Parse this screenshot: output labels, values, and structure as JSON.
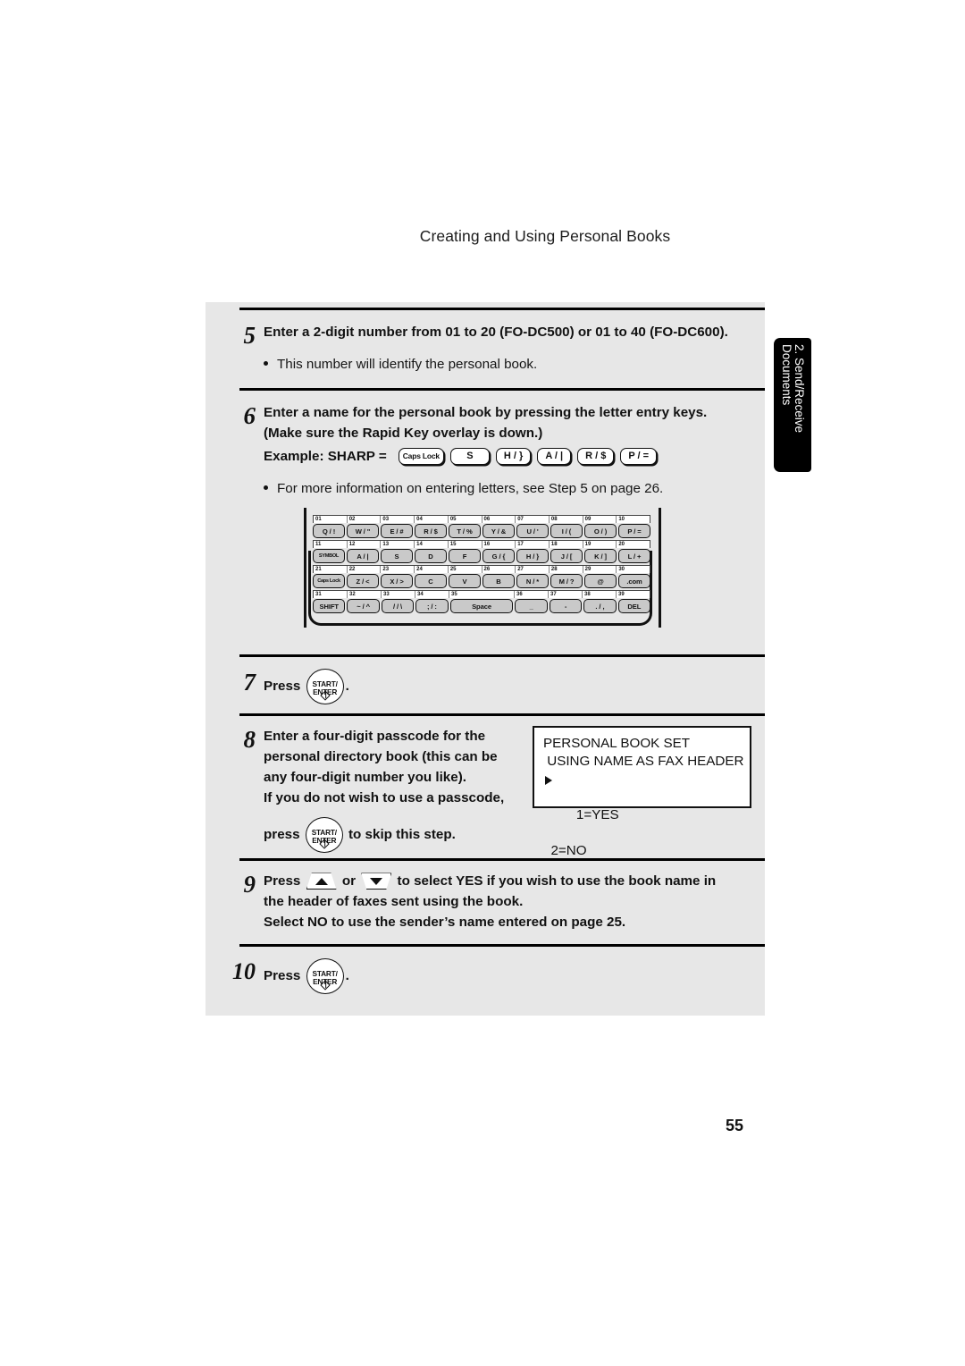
{
  "document": {
    "running_head": "Creating and Using Personal Books",
    "page_number": "55"
  },
  "side_tab": {
    "line1": "2. Send/Receive",
    "line2": "Documents"
  },
  "steps": [
    {
      "number": "5",
      "heading": "Enter a 2-digit number from 01 to 20 (FO-DC500) or 01 to 40 (FO-DC600).",
      "bullet": "This number will identify the personal book."
    },
    {
      "number": "6",
      "heading_line1": "Enter a name for the personal book by pressing the letter entry keys.",
      "heading_line2": "(Make sure the Rapid Key overlay is down.)",
      "example_label": "Example: SHARP =",
      "example_keys": [
        "Caps Lock",
        "S",
        "H / }",
        "A / |",
        "R / $",
        "P / ="
      ],
      "bullet": "For more information on entering letters, see Step 5 on page 26."
    },
    {
      "number": "7",
      "press_label": "Press",
      "period": "."
    },
    {
      "number": "8",
      "line1": "Enter a four-digit passcode for the",
      "line2": "personal directory book (this can be",
      "line3": "any four-digit number you like).",
      "line4": "If you do not wish to use a passcode,",
      "press_label": "press",
      "after_key": "to skip this step."
    },
    {
      "number": "9",
      "press_label": "Press",
      "or_label": "or",
      "line1_tail": "to select YES if you wish to use the book name in",
      "line2": "the header of faxes sent using the book.",
      "line3": "Select NO to use the sender’s name entered on page 25."
    },
    {
      "number": "10",
      "press_label": "Press",
      "period": "."
    }
  ],
  "enter_key": {
    "line1": "START/",
    "line2": "ENTER"
  },
  "lcd": {
    "line1": "PERSONAL BOOK SET",
    "line2": " USING NAME AS FAX HEADER",
    "line3": "1=YES",
    "line4": "  2=NO"
  },
  "keyboard": {
    "rows": [
      {
        "numbers": [
          "01",
          "02",
          "03",
          "04",
          "05",
          "06",
          "07",
          "08",
          "09",
          "10"
        ],
        "keys": [
          {
            "label": "Q / !",
            "flex": 1
          },
          {
            "label": "W / \"",
            "flex": 1
          },
          {
            "label": "E / #",
            "flex": 1
          },
          {
            "label": "R / $",
            "flex": 1
          },
          {
            "label": "T / %",
            "flex": 1
          },
          {
            "label": "Y / &",
            "flex": 1
          },
          {
            "label": "U / '",
            "flex": 1
          },
          {
            "label": "I / (",
            "flex": 1
          },
          {
            "label": "O / )",
            "flex": 1
          },
          {
            "label": "P / =",
            "flex": 1
          }
        ]
      },
      {
        "numbers": [
          "11",
          "12",
          "13",
          "14",
          "15",
          "16",
          "17",
          "18",
          "19",
          "20"
        ],
        "keys": [
          {
            "label": "SYMBOL",
            "flex": 1,
            "small": true
          },
          {
            "label": "A / |",
            "flex": 1
          },
          {
            "label": "S",
            "flex": 1
          },
          {
            "label": "D",
            "flex": 1
          },
          {
            "label": "F",
            "flex": 1
          },
          {
            "label": "G / {",
            "flex": 1
          },
          {
            "label": "H / }",
            "flex": 1
          },
          {
            "label": "J / [",
            "flex": 1
          },
          {
            "label": "K / ]",
            "flex": 1
          },
          {
            "label": "L / +",
            "flex": 1
          }
        ]
      },
      {
        "numbers": [
          "21",
          "22",
          "23",
          "24",
          "25",
          "26",
          "27",
          "28",
          "29",
          "30"
        ],
        "keys": [
          {
            "label": "Caps Lock",
            "flex": 1,
            "small": true
          },
          {
            "label": "Z / <",
            "flex": 1
          },
          {
            "label": "X / >",
            "flex": 1
          },
          {
            "label": "C",
            "flex": 1
          },
          {
            "label": "V",
            "flex": 1
          },
          {
            "label": "B",
            "flex": 1
          },
          {
            "label": "N / *",
            "flex": 1
          },
          {
            "label": "M / ?",
            "flex": 1
          },
          {
            "label": "@",
            "flex": 1
          },
          {
            "label": ".com",
            "flex": 1
          }
        ]
      },
      {
        "numbers": [
          "31",
          "32",
          "33",
          "34",
          "35",
          "36",
          "37",
          "38",
          "39"
        ],
        "number_flex": [
          1,
          1,
          1,
          1,
          2,
          1,
          1,
          1,
          1
        ],
        "keys": [
          {
            "label": "SHIFT",
            "flex": 1
          },
          {
            "label": "~ / ^",
            "flex": 1
          },
          {
            "label": "/ / \\",
            "flex": 1
          },
          {
            "label": "; / :",
            "flex": 1
          },
          {
            "label": "Space",
            "flex": 2
          },
          {
            "label": "_",
            "flex": 1
          },
          {
            "label": "-",
            "flex": 1
          },
          {
            "label": ". / ,",
            "flex": 1
          },
          {
            "label": "DEL",
            "flex": 1
          }
        ]
      }
    ]
  }
}
